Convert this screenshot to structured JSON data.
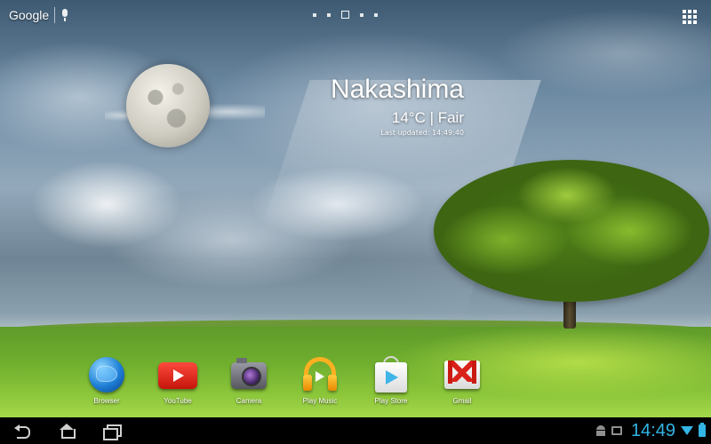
{
  "top_bar": {
    "search_label": "Google",
    "search_icon": "mic-icon",
    "apps_icon": "apps-grid-icon"
  },
  "home_pages": {
    "count": 5,
    "current": 3
  },
  "weather": {
    "city": "Nakashima",
    "condition": "14°C | Fair",
    "last_updated": "Last updated: 14:49:40",
    "icon": "moon-icon"
  },
  "dock": {
    "apps": [
      {
        "label": "Browser",
        "icon": "browser-globe-icon"
      },
      {
        "label": "YouTube",
        "icon": "youtube-icon"
      },
      {
        "label": "Camera",
        "icon": "camera-icon"
      },
      {
        "label": "Play Music",
        "icon": "play-music-icon"
      },
      {
        "label": "Play Store",
        "icon": "play-store-icon"
      },
      {
        "label": "Gmail",
        "icon": "gmail-icon"
      }
    ]
  },
  "nav_bar": {
    "clock": "14:49",
    "accent_color": "#33b5e5",
    "buttons": [
      "back-icon",
      "home-icon",
      "recent-apps-icon"
    ]
  }
}
